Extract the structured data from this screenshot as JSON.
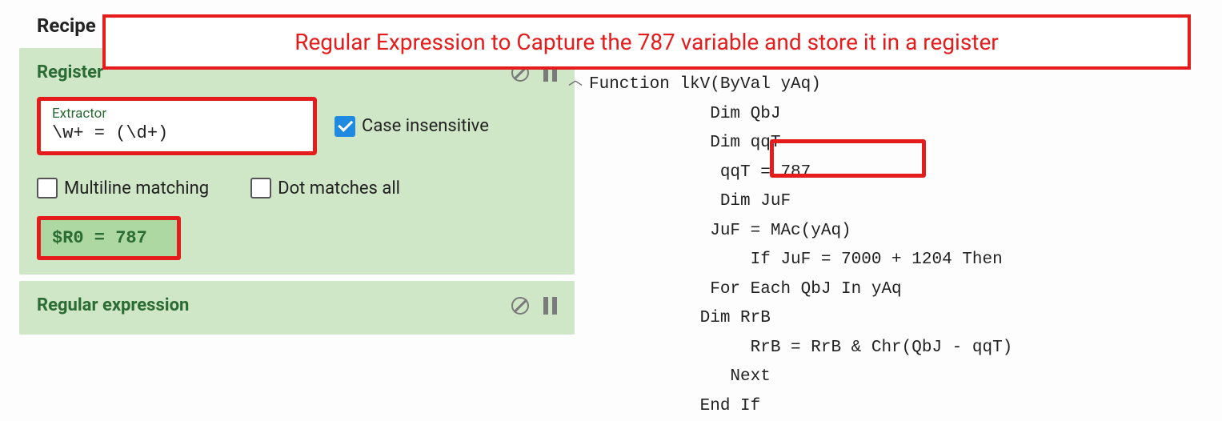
{
  "annotation": "Regular Expression to Capture the 787 variable and store it in a register",
  "recipe": {
    "title": "Recipe"
  },
  "register_op": {
    "title": "Register",
    "extractor_label": "Extractor",
    "extractor_value": "\\w+ = (\\d+)",
    "case_insensitive_label": "Case insensitive",
    "multiline_label": "Multiline matching",
    "dot_matches_label": "Dot matches all",
    "result": "$R0 = 787"
  },
  "regex_op": {
    "title": "Regular expression"
  },
  "code": {
    "lines": [
      "Function lkV(ByVal yAq)",
      "            Dim QbJ",
      "            Dim qqT",
      "             qqT = 787",
      "             Dim JuF",
      "            JuF = MAc(yAq)",
      "                If JuF = 7000 + 1204 Then",
      "            For Each QbJ In yAq",
      "           Dim RrB",
      "                RrB = RrB & Chr(QbJ - qqT)",
      "              Next",
      "           End If"
    ]
  }
}
